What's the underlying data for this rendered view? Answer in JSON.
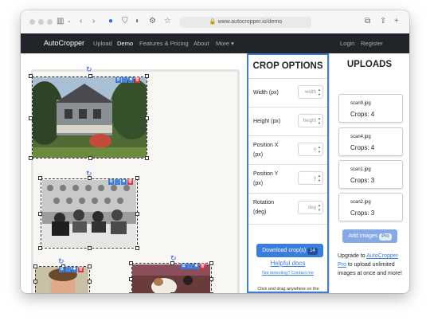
{
  "browser": {
    "url": "www.autocropper.io/demo",
    "icons": [
      "sidebar-icon",
      "chevron-down-icon",
      "back-arrow-icon",
      "forward-arrow-icon",
      "extension-icon",
      "shield-icon",
      "half-circle-icon",
      "gear-icon",
      "star-icon",
      "lock-icon",
      "translate-icon",
      "share-icon",
      "new-tab-icon"
    ]
  },
  "navbar": {
    "brand": "AutoCropper",
    "links": [
      "Upload",
      "Demo",
      "Features & Pricing",
      "About",
      "More ▾"
    ],
    "active": "Demo",
    "right_links": [
      "Login",
      "Register"
    ]
  },
  "canvas": {
    "rotate_glyph": "↻",
    "control_glyphs": [
      "⧉",
      "⬚",
      "✱",
      "🗑"
    ]
  },
  "crop_options": {
    "title": "CROP OPTIONS",
    "fields": [
      {
        "label": "Width (px)",
        "placeholder": "width"
      },
      {
        "label": "Height (px)",
        "placeholder": "height"
      },
      {
        "label": "Position X (px)",
        "placeholder": "x"
      },
      {
        "label": "Position Y (px)",
        "placeholder": "y"
      },
      {
        "label": "Rotation (deg)",
        "placeholder": "deg"
      }
    ],
    "download_label": "Download crop(s)",
    "download_count": "14",
    "helpful_docs": "Helpful docs",
    "not_detecting": "Not detecting? Contact me",
    "hint": "Click and drag anywhere on the canvas to create a new crop"
  },
  "uploads": {
    "title": "UPLOADS",
    "items": [
      {
        "name": "scan9.jpg",
        "crops": "Crops: 4"
      },
      {
        "name": "scan4.jpg",
        "crops": "Crops: 4"
      },
      {
        "name": "scan1.jpg",
        "crops": "Crops: 3"
      },
      {
        "name": "scan2.jpg",
        "crops": "Crops: 3"
      }
    ],
    "add_label": "Add images",
    "pro_badge": "Pro",
    "upgrade_prefix": "Upgrade to",
    "upgrade_link": "AutoCropper Pro",
    "upgrade_suffix": "to upload unlimited images at once and more!"
  },
  "colors": {
    "accent": "#3b7ddd",
    "navbar": "#212529"
  }
}
